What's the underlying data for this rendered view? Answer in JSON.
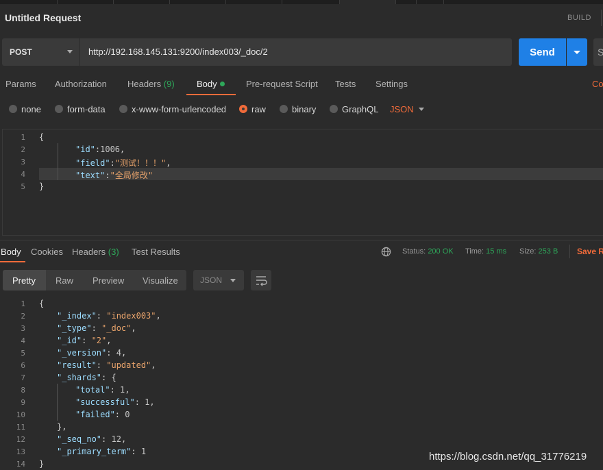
{
  "request": {
    "title": "Untitled Request",
    "build_label": "BUILD",
    "method": "POST",
    "url": "http://192.168.145.131:9200/index003/_doc/2",
    "send_label": "Send",
    "save_stub": "S"
  },
  "request_tabs": {
    "params": "Params",
    "authorization": "Authorization",
    "headers": "Headers",
    "headers_count": "(9)",
    "body": "Body",
    "prerequest": "Pre-request Script",
    "tests": "Tests",
    "settings": "Settings",
    "cookies_trunc": "Coo"
  },
  "body_types": {
    "none": "none",
    "form_data": "form-data",
    "urlencoded": "x-www-form-urlencoded",
    "raw": "raw",
    "binary": "binary",
    "graphql": "GraphQL",
    "format": "JSON",
    "selected": "raw"
  },
  "request_body": {
    "line_numbers": [
      "1",
      "2",
      "3",
      "4",
      "5"
    ],
    "l1": "{",
    "l2_key": "\"id\"",
    "l2_rest": ":1006,",
    "l3_key": "\"field\"",
    "l3_colon": ":",
    "l3_val": "\"测试！！！\"",
    "l3_comma": ",",
    "l4_key": "\"text\"",
    "l4_colon": ":",
    "l4_val": "\"全局修改\"",
    "l5": "}"
  },
  "response_tabs": {
    "body": "Body",
    "cookies": "Cookies",
    "headers": "Headers",
    "headers_count": "(3)",
    "test_results": "Test Results"
  },
  "response_status": {
    "status_label": "Status:",
    "status_value": "200 OK",
    "time_label": "Time:",
    "time_value": "15 ms",
    "size_label": "Size:",
    "size_value": "253 B",
    "save_response": "Save R"
  },
  "view_modes": {
    "pretty": "Pretty",
    "raw": "Raw",
    "preview": "Preview",
    "visualize": "Visualize",
    "format": "JSON"
  },
  "response_body": {
    "line_numbers": [
      "1",
      "2",
      "3",
      "4",
      "5",
      "6",
      "7",
      "8",
      "9",
      "10",
      "11",
      "12",
      "13",
      "14"
    ],
    "l1": "{",
    "l2_key": "\"_index\"",
    "l2_val": "\"index003\"",
    "l3_key": "\"_type\"",
    "l3_val": "\"_doc\"",
    "l4_key": "\"_id\"",
    "l4_val": "\"2\"",
    "l5_key": "\"_version\"",
    "l5_val": "4",
    "l6_key": "\"result\"",
    "l6_val": "\"updated\"",
    "l7_key": "\"_shards\"",
    "l7_val": "{",
    "l8_key": "\"total\"",
    "l8_val": "1",
    "l9_key": "\"successful\"",
    "l9_val": "1",
    "l10_key": "\"failed\"",
    "l10_val": "0",
    "l11": "},",
    "l12_key": "\"_seq_no\"",
    "l12_val": "12",
    "l13_key": "\"_primary_term\"",
    "l13_val": "1",
    "l14": "}"
  },
  "watermark": "https://blog.csdn.net/qq_31776219",
  "colors": {
    "accent": "#f26b3a",
    "send": "#1f80e6",
    "ok": "#2ea85a",
    "background": "#2b2b2b"
  }
}
